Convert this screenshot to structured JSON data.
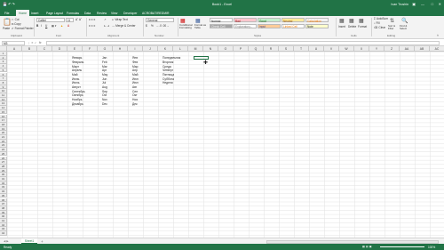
{
  "title": {
    "text": "Book1 - Excel",
    "user": "Ivan Trushin",
    "controls": [
      "ribbon-options",
      "minimize",
      "restore",
      "close"
    ]
  },
  "tabs": [
    "File",
    "Home",
    "Insert",
    "Page Layout",
    "Formulas",
    "Data",
    "Review",
    "View",
    "Developer",
    "ACROBAT/REDMIR"
  ],
  "active_tab": "Home",
  "tell_me": "Tell me what you want to do...",
  "share": "Share",
  "ribbon": {
    "clipboard": {
      "cut": "Cut",
      "copy": "Copy",
      "format_painter": "Format Painter",
      "paste": "Paste",
      "group": "Clipboard"
    },
    "font": {
      "name": "Calibri",
      "size": "11",
      "group": "Font",
      "bold": "B",
      "italic": "I",
      "underline": "U"
    },
    "alignment": {
      "wrap": "Wrap Text",
      "merge": "Merge & Center",
      "group": "Alignment"
    },
    "number": {
      "format": "General",
      "group": "Number",
      "currency": "$",
      "percent": "%"
    },
    "styles": {
      "conditional": "Conditional Formatting",
      "table": "Format as Table",
      "items": [
        {
          "label": "Normal",
          "bg": "#ffffff",
          "fg": "#222222"
        },
        {
          "label": "Bad",
          "bg": "#ffc7ce",
          "fg": "#9c0006"
        },
        {
          "label": "Good",
          "bg": "#c6efce",
          "fg": "#006100"
        },
        {
          "label": "Neutral",
          "bg": "#ffeb9c",
          "fg": "#9c5700"
        },
        {
          "label": "Calculation",
          "bg": "#f2f2f2",
          "fg": "#fa7d00"
        },
        {
          "label": "Check Cell",
          "bg": "#a5a5a5",
          "fg": "#ffffff"
        },
        {
          "label": "Explanatory...",
          "bg": "#ffffff",
          "fg": "#7f7f7f"
        },
        {
          "label": "Input",
          "bg": "#ffcc99",
          "fg": "#3f3f76"
        },
        {
          "label": "Linked Cell",
          "bg": "#ffffff",
          "fg": "#fa7d00"
        },
        {
          "label": "Note",
          "bg": "#ffffcc",
          "fg": "#222222"
        }
      ],
      "group": "Styles"
    },
    "cells": {
      "insert": "Insert",
      "delete": "Delete",
      "format": "Format",
      "group": "Cells"
    },
    "editing": {
      "autosum": "AutoSum",
      "fill": "Fill",
      "clear": "Clear",
      "sort": "Sort & Filter",
      "find": "Find & Select",
      "group": "Editing"
    }
  },
  "formula_bar": {
    "name_box": "M3",
    "fx": "fx",
    "value": ""
  },
  "columns": [
    "A",
    "B",
    "C",
    "D",
    "E",
    "F",
    "G",
    "H",
    "I",
    "J",
    "K",
    "L",
    "M",
    "N",
    "O",
    "P",
    "Q",
    "R",
    "S",
    "T",
    "U",
    "V",
    "W",
    "X",
    "Y",
    "Z",
    "AA",
    "AB",
    "AC"
  ],
  "rows": [
    "1",
    "2",
    "3",
    "4",
    "5",
    "6",
    "7",
    "8",
    "9",
    "10",
    "11",
    "12",
    "13",
    "14",
    "15",
    "16",
    "17",
    "18",
    "19",
    "20",
    "21",
    "22",
    "23",
    "24",
    "25",
    "26",
    "27",
    "28",
    "29",
    "30",
    "31",
    "32",
    "33",
    "34",
    "35",
    "36",
    "37",
    "38",
    "39",
    "40",
    "41",
    "42",
    "43",
    "44"
  ],
  "cells": {
    "months": [
      "Январь",
      "Февраль",
      "Март",
      "Апрель",
      "Май",
      "Июнь",
      "Июль",
      "Август",
      "Сентябрь",
      "Октябрь",
      "Ноябрь",
      "Декабрь"
    ],
    "short_en": [
      "Jan",
      "Feb",
      "Mar",
      "Apr",
      "May",
      "Jun",
      "Jul",
      "Aug",
      "Sep",
      "Oct",
      "Nov",
      "Dec"
    ],
    "short_ru": [
      "Янв",
      "Фев",
      "Мар",
      "Апр",
      "Май",
      "Июн",
      "Июл",
      "Авг",
      "Сен",
      "Окт",
      "Ноя",
      "Дек"
    ],
    "days": [
      "Понедельник",
      "Вторник",
      "Среда",
      "Четверг",
      "Пятница",
      "Суббота",
      "Неделя"
    ]
  },
  "sheet": {
    "name": "Sheet1",
    "add": "+"
  },
  "status": {
    "ready": "Ready",
    "zoom": "100%"
  }
}
